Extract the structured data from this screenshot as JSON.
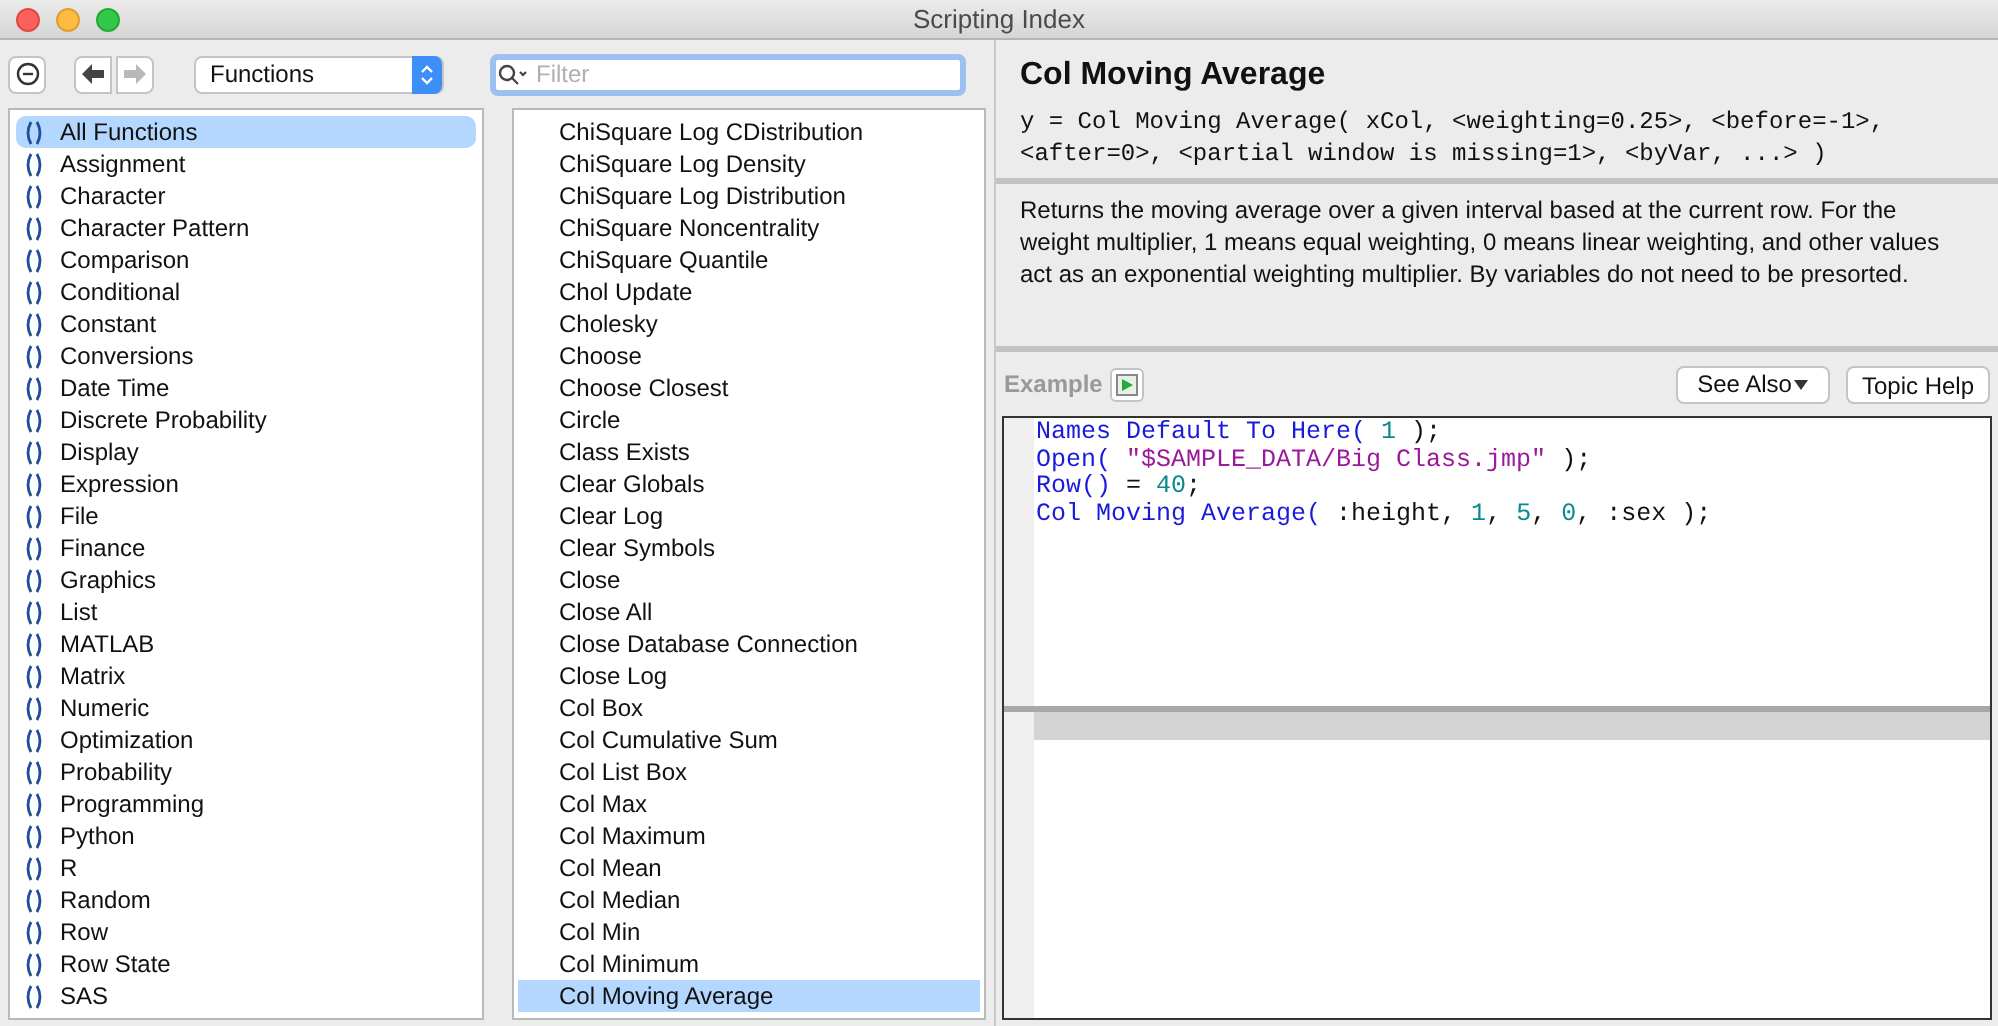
{
  "window": {
    "title": "Scripting Index"
  },
  "toolbar": {
    "category": "Functions",
    "search": {
      "placeholder": "Filter"
    },
    "forward_disabled": true
  },
  "categories": [
    {
      "label": "All Functions",
      "selected": true
    },
    {
      "label": "Assignment",
      "selected": false
    },
    {
      "label": "Character",
      "selected": false
    },
    {
      "label": "Character Pattern",
      "selected": false
    },
    {
      "label": "Comparison",
      "selected": false
    },
    {
      "label": "Conditional",
      "selected": false
    },
    {
      "label": "Constant",
      "selected": false
    },
    {
      "label": "Conversions",
      "selected": false
    },
    {
      "label": "Date Time",
      "selected": false
    },
    {
      "label": "Discrete Probability",
      "selected": false
    },
    {
      "label": "Display",
      "selected": false
    },
    {
      "label": "Expression",
      "selected": false
    },
    {
      "label": "File",
      "selected": false
    },
    {
      "label": "Finance",
      "selected": false
    },
    {
      "label": "Graphics",
      "selected": false
    },
    {
      "label": "List",
      "selected": false
    },
    {
      "label": "MATLAB",
      "selected": false
    },
    {
      "label": "Matrix",
      "selected": false
    },
    {
      "label": "Numeric",
      "selected": false
    },
    {
      "label": "Optimization",
      "selected": false
    },
    {
      "label": "Probability",
      "selected": false
    },
    {
      "label": "Programming",
      "selected": false
    },
    {
      "label": "Python",
      "selected": false
    },
    {
      "label": "R",
      "selected": false
    },
    {
      "label": "Random",
      "selected": false
    },
    {
      "label": "Row",
      "selected": false
    },
    {
      "label": "Row State",
      "selected": false
    },
    {
      "label": "SAS",
      "selected": false
    }
  ],
  "functions": [
    {
      "label": "ChiSquare Log CDistribution",
      "selected": false
    },
    {
      "label": "ChiSquare Log Density",
      "selected": false
    },
    {
      "label": "ChiSquare Log Distribution",
      "selected": false
    },
    {
      "label": "ChiSquare Noncentrality",
      "selected": false
    },
    {
      "label": "ChiSquare Quantile",
      "selected": false
    },
    {
      "label": "Chol Update",
      "selected": false
    },
    {
      "label": "Cholesky",
      "selected": false
    },
    {
      "label": "Choose",
      "selected": false
    },
    {
      "label": "Choose Closest",
      "selected": false
    },
    {
      "label": "Circle",
      "selected": false
    },
    {
      "label": "Class Exists",
      "selected": false
    },
    {
      "label": "Clear Globals",
      "selected": false
    },
    {
      "label": "Clear Log",
      "selected": false
    },
    {
      "label": "Clear Symbols",
      "selected": false
    },
    {
      "label": "Close",
      "selected": false
    },
    {
      "label": "Close All",
      "selected": false
    },
    {
      "label": "Close Database Connection",
      "selected": false
    },
    {
      "label": "Close Log",
      "selected": false
    },
    {
      "label": "Col Box",
      "selected": false
    },
    {
      "label": "Col Cumulative Sum",
      "selected": false
    },
    {
      "label": "Col List Box",
      "selected": false
    },
    {
      "label": "Col Max",
      "selected": false
    },
    {
      "label": "Col Maximum",
      "selected": false
    },
    {
      "label": "Col Mean",
      "selected": false
    },
    {
      "label": "Col Median",
      "selected": false
    },
    {
      "label": "Col Min",
      "selected": false
    },
    {
      "label": "Col Minimum",
      "selected": false
    },
    {
      "label": "Col Moving Average",
      "selected": true
    }
  ],
  "detail": {
    "title": "Col Moving Average",
    "signature": "y = Col Moving Average( xCol, <weighting=0.25>, <before=-1>, <after=0>, <partial window is missing=1>, <byVar, ...> )",
    "description": "Returns the moving average over a given interval based at the current row. For the weight multiplier, 1 means equal weighting, 0 means linear weighting, and other values act as an exponential weighting multiplier. By variables do not need to be presorted.",
    "example_label": "Example",
    "see_also": "See Also",
    "topic_help": "Topic Help",
    "code": [
      [
        {
          "kind": "keyword",
          "text": "Names Default To Here("
        },
        {
          "kind": "number",
          "text": " 1"
        },
        {
          "kind": "plain",
          "text": " );"
        }
      ],
      [
        {
          "kind": "keyword",
          "text": "Open("
        },
        {
          "kind": "string",
          "text": " \"$SAMPLE_DATA/Big Class.jmp\""
        },
        {
          "kind": "plain",
          "text": " );"
        }
      ],
      [
        {
          "kind": "keyword",
          "text": "Row()"
        },
        {
          "kind": "plain",
          "text": " = "
        },
        {
          "kind": "number",
          "text": "40"
        },
        {
          "kind": "plain",
          "text": ";"
        }
      ],
      [
        {
          "kind": "keyword",
          "text": "Col Moving Average("
        },
        {
          "kind": "plain",
          "text": " :height, "
        },
        {
          "kind": "number",
          "text": "1"
        },
        {
          "kind": "plain",
          "text": ", "
        },
        {
          "kind": "number",
          "text": "5"
        },
        {
          "kind": "plain",
          "text": ", "
        },
        {
          "kind": "number",
          "text": "0"
        },
        {
          "kind": "plain",
          "text": ", :sex );"
        }
      ]
    ]
  }
}
